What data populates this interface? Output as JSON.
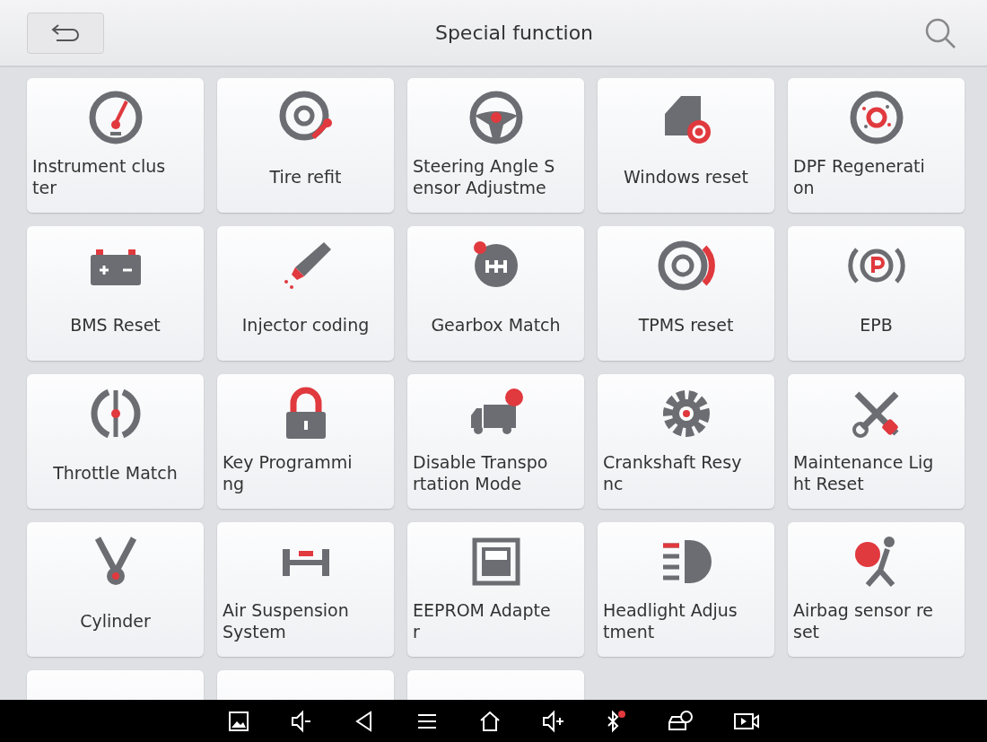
{
  "header": {
    "title": "Special function"
  },
  "functions": [
    {
      "lines": [
        "Instrument clus",
        "ter"
      ]
    },
    {
      "lines": [
        "Tire refit"
      ]
    },
    {
      "lines": [
        "Steering Angle S",
        "ensor Adjustme"
      ]
    },
    {
      "lines": [
        "Windows reset"
      ]
    },
    {
      "lines": [
        "DPF Regenerati",
        "on"
      ]
    },
    {
      "lines": [
        "BMS Reset"
      ]
    },
    {
      "lines": [
        "Injector coding"
      ]
    },
    {
      "lines": [
        "Gearbox Match"
      ]
    },
    {
      "lines": [
        "TPMS reset"
      ]
    },
    {
      "lines": [
        "EPB"
      ]
    },
    {
      "lines": [
        "Throttle Match"
      ]
    },
    {
      "lines": [
        "Key Programmi",
        "ng"
      ]
    },
    {
      "lines": [
        "Disable Transpo",
        "rtation Mode"
      ]
    },
    {
      "lines": [
        "Crankshaft Resy",
        "nc"
      ]
    },
    {
      "lines": [
        "Maintenance Lig",
        "ht Reset"
      ]
    },
    {
      "lines": [
        "Cylinder"
      ]
    },
    {
      "lines": [
        "Air Suspension",
        "System"
      ]
    },
    {
      "lines": [
        "EEPROM Adapte",
        "r"
      ]
    },
    {
      "lines": [
        "Headlight Adjus",
        "tment"
      ]
    },
    {
      "lines": [
        "Airbag sensor re",
        "set"
      ]
    }
  ]
}
